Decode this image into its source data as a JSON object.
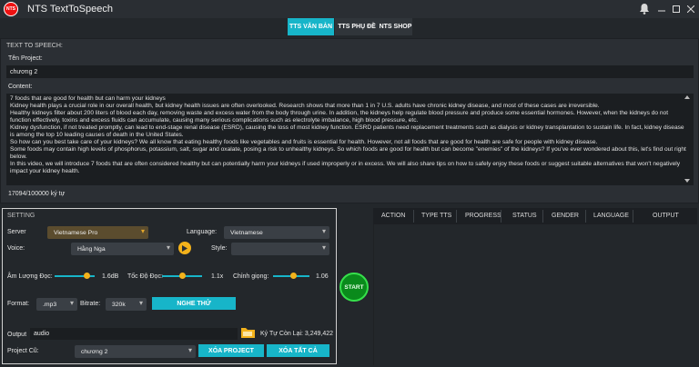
{
  "window": {
    "title": "NTS TextToSpeech",
    "logo_text": "NTS"
  },
  "tabs": [
    {
      "label": "TTS VĂN BẢN"
    },
    {
      "label": "TTS PHỤ ĐỀ"
    },
    {
      "label": "NTS SHOP"
    }
  ],
  "tts": {
    "section_label": "TEXT TO SPEECH:",
    "project_label": "Tên Project:",
    "project_value": "chương 2",
    "content_label": "Content:",
    "content_lines": [
      "7 foods that are good for health but can harm your kidneys",
      "Kidney health plays a crucial role in our overall health, but kidney health issues are often overlooked. Research shows that more than 1 in 7 U.S. adults have chronic kidney disease, and most of these cases are irreversible.",
      "Healthy kidneys filter about 200 liters of blood each day, removing waste and excess water from the body through urine. In addition, the kidneys help regulate blood pressure and produce some essential hormones. However, when the kidneys do not function effectively, toxins and excess fluids can accumulate, causing many serious complications such as electrolyte imbalance, high blood pressure, etc.",
      "Kidney dysfunction, if not treated promptly, can lead to end-stage renal disease (ESRD), causing the loss of most kidney function. ESRD patients need replacement treatments such as dialysis or kidney transplantation to sustain life. In fact, kidney disease is among the top 10 leading causes of death in the United States.",
      "So how can you best take care of your kidneys? We all know that eating healthy foods like vegetables and fruits is essential for health. However, not all foods that are good for health are safe for people with kidney disease.",
      "Some foods may contain high levels of phosphorus, potassium, salt, sugar and oxalate, posing a risk to unhealthy kidneys. So which foods are good for health but can become \"enemies\" of the kidneys? If you've ever wondered about this, let's find out right below.",
      "In this video, we will introduce 7 foods that are often considered healthy but can potentially harm your kidneys if used improperly or in excess. We will also share tips on how to safely enjoy these foods or suggest suitable alternatives that won't negatively impact your kidney health."
    ],
    "char_count": "17094/100000 ký tự"
  },
  "setting": {
    "title": "SETTING",
    "server_label": "Server",
    "server_value": "Vietnamese Pro",
    "language_label": "Language:",
    "language_value": "Vietnamese",
    "voice_label": "Voice:",
    "voice_value": "Hằng Nga",
    "style_label": "Style:",
    "style_value": "",
    "volume_label": "Âm Lượng Đọc:",
    "volume_value": "1.6dB",
    "volume_level": 0.8,
    "speed_label": "Tốc Độ Đọc:",
    "speed_value": "1.1x",
    "speed_level": 0.5,
    "pitch_label": "Chỉnh giọng:",
    "pitch_value": "1.06",
    "pitch_level": 0.55,
    "format_label": "Format:",
    "format_value": ".mp3",
    "bitrate_label": "Bitrate:",
    "bitrate_value": "320k",
    "listen_button": "NGHE THỬ",
    "output_label": "Output",
    "output_value": "audio",
    "remaining_label": "Ký Tự Còn Lại: 3,249,422",
    "old_project_label": "Project Cũ:",
    "old_project_value": "chương 2",
    "delete_project_button": "XÓA PROJECT",
    "delete_all_button": "XÓA TẤT CẢ",
    "start_button": "START"
  },
  "table": {
    "columns": [
      "ACTION",
      "TYPE TTS",
      "PROGRESS",
      "STATUS",
      "GENDER",
      "LANGUAGE",
      "OUTPUT"
    ]
  },
  "colors": {
    "accent": "#17b5c9",
    "knob": "#f3b21b",
    "start_green": "#0a8a1b"
  }
}
